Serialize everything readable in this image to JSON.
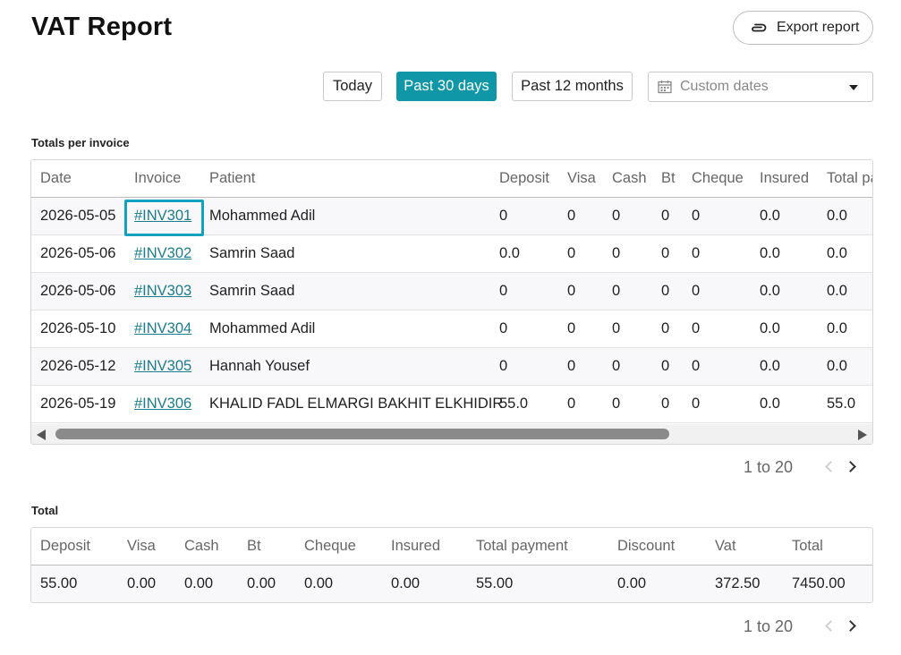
{
  "header": {
    "title": "VAT Report",
    "export_label": "Export report"
  },
  "filters": {
    "today": "Today",
    "past_30_days": "Past 30 days",
    "past_12_months": "Past 12 months",
    "custom_dates_placeholder": "Custom dates",
    "active": "past_30_days"
  },
  "colors": {
    "accent": "#0f97a8",
    "link": "#1a7c8c",
    "focus_outline": "#12a2c0"
  },
  "invoices": {
    "section_label": "Totals per invoice",
    "columns": [
      "Date",
      "Invoice",
      "Patient",
      "Deposit",
      "Visa",
      "Cash",
      "Bt",
      "Cheque",
      "Insured",
      "Total pa"
    ],
    "rows": [
      [
        "2026-05-05",
        "#INV301",
        "Mohammed Adil",
        "0",
        "0",
        "0",
        "0",
        "0",
        "0.0",
        "0.0"
      ],
      [
        "2026-05-06",
        "#INV302",
        "Samrin Saad",
        "0.0",
        "0",
        "0",
        "0",
        "0",
        "0.0",
        "0.0"
      ],
      [
        "2026-05-06",
        "#INV303",
        "Samrin Saad",
        "0",
        "0",
        "0",
        "0",
        "0",
        "0.0",
        "0.0"
      ],
      [
        "2026-05-10",
        "#INV304",
        "Mohammed Adil",
        "0",
        "0",
        "0",
        "0",
        "0",
        "0.0",
        "0.0"
      ],
      [
        "2026-05-12",
        "#INV305",
        "Hannah Yousef",
        "0",
        "0",
        "0",
        "0",
        "0",
        "0.0",
        "0.0"
      ],
      [
        "2026-05-19",
        "#INV306",
        "KHALID FADL ELMARGI BAKHIT ELKHIDIR",
        "55.0",
        "0",
        "0",
        "0",
        "0",
        "0.0",
        "55.0"
      ]
    ],
    "pager": "1 to 20"
  },
  "totals": {
    "section_label": "Total",
    "columns": [
      "Deposit",
      "Visa",
      "Cash",
      "Bt",
      "Cheque",
      "Insured",
      "Total payment",
      "Discount",
      "Vat",
      "Total"
    ],
    "row": [
      "55.00",
      "0.00",
      "0.00",
      "0.00",
      "0.00",
      "0.00",
      "55.00",
      "0.00",
      "372.50",
      "7450.00"
    ],
    "pager": "1 to 20"
  }
}
